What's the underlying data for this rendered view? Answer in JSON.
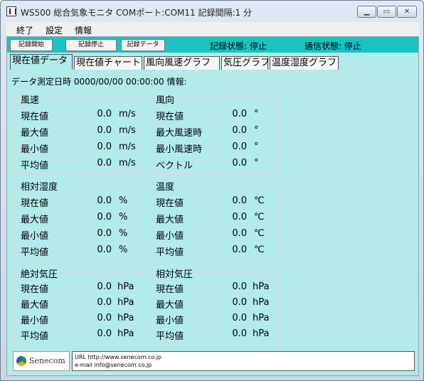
{
  "window": {
    "title": "WS500 総合気象モニタ COMポート:COM11 記録間隔:1 分"
  },
  "menu": {
    "items": [
      "終了",
      "設定",
      "情報"
    ]
  },
  "toolbar": {
    "start_label": "記録開始",
    "stop_label": "記録停止",
    "data_label": "記録データ",
    "record_status": "記録状態:  停止",
    "comm_status": "通信状態:  停止"
  },
  "tabs": [
    "現在値データ",
    "現在値チャート",
    "風向風速グラフ",
    "気圧グラフ",
    "温度湿度グラフ"
  ],
  "info_line": "データ測定日時 0000/00/00 00:00:00   情報:",
  "groups": {
    "wind_speed": {
      "title": "風速",
      "rows": [
        {
          "label": "現在値",
          "value": "0.0",
          "unit": "m/s"
        },
        {
          "label": "最大値",
          "value": "0.0",
          "unit": "m/s"
        },
        {
          "label": "最小値",
          "value": "0.0",
          "unit": "m/s"
        },
        {
          "label": "平均値",
          "value": "0.0",
          "unit": "m/s"
        }
      ]
    },
    "wind_dir": {
      "title": "風向",
      "rows": [
        {
          "label": "現在値",
          "value": "0.0",
          "unit": "°"
        },
        {
          "label": "最大風速時",
          "value": "0.0",
          "unit": "°"
        },
        {
          "label": "最小風速時",
          "value": "0.0",
          "unit": "°"
        },
        {
          "label": "ベクトル",
          "value": "0.0",
          "unit": "°"
        }
      ]
    },
    "humidity": {
      "title": "相対湿度",
      "rows": [
        {
          "label": "現在値",
          "value": "0.0",
          "unit": "%"
        },
        {
          "label": "最大値",
          "value": "0.0",
          "unit": "%"
        },
        {
          "label": "最小値",
          "value": "0.0",
          "unit": "%"
        },
        {
          "label": "平均値",
          "value": "0.0",
          "unit": "%"
        }
      ]
    },
    "temperature": {
      "title": "温度",
      "rows": [
        {
          "label": "現在値",
          "value": "0.0",
          "unit": "℃"
        },
        {
          "label": "最大値",
          "value": "0.0",
          "unit": "℃"
        },
        {
          "label": "最小値",
          "value": "0.0",
          "unit": "℃"
        },
        {
          "label": "平均値",
          "value": "0.0",
          "unit": "℃"
        }
      ]
    },
    "abs_pressure": {
      "title": "絶対気圧",
      "rows": [
        {
          "label": "現在値",
          "value": "0.0",
          "unit": "hPa"
        },
        {
          "label": "最大値",
          "value": "0.0",
          "unit": "hPa"
        },
        {
          "label": "最小値",
          "value": "0.0",
          "unit": "hPa"
        },
        {
          "label": "平均値",
          "value": "0.0",
          "unit": "hPa"
        }
      ]
    },
    "rel_pressure": {
      "title": "相対気圧",
      "rows": [
        {
          "label": "現在値",
          "value": "0.0",
          "unit": "hPa"
        },
        {
          "label": "最大値",
          "value": "0.0",
          "unit": "hPa"
        },
        {
          "label": "最小値",
          "value": "0.0",
          "unit": "hPa"
        },
        {
          "label": "平均値",
          "value": "0.0",
          "unit": "hPa"
        }
      ]
    }
  },
  "footer": {
    "logo_text": "Senecom",
    "url_line": "URL http://www.senecom.co.jp",
    "email_line": "e-mail  info@senecom.co.jp"
  }
}
